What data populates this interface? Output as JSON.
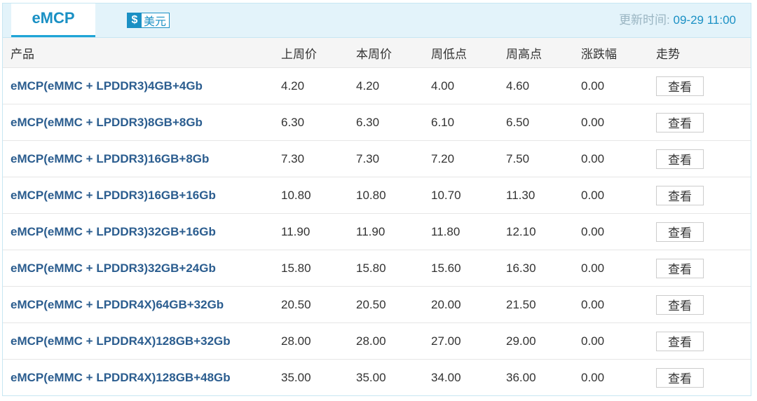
{
  "tabs": {
    "active_label": "eMCP"
  },
  "currency": {
    "icon_glyph": "$",
    "label": "美元"
  },
  "update": {
    "label": "更新时间: ",
    "value": "09-29 11:00"
  },
  "table": {
    "headers": [
      "产品",
      "上周价",
      "本周价",
      "周低点",
      "周高点",
      "涨跌幅",
      "走势"
    ],
    "view_label": "查看",
    "rows": [
      {
        "product": "eMCP(eMMC + LPDDR3)4GB+4Gb",
        "last_week": "4.20",
        "this_week": "4.20",
        "low": "4.00",
        "high": "4.60",
        "change": "0.00"
      },
      {
        "product": "eMCP(eMMC + LPDDR3)8GB+8Gb",
        "last_week": "6.30",
        "this_week": "6.30",
        "low": "6.10",
        "high": "6.50",
        "change": "0.00"
      },
      {
        "product": "eMCP(eMMC + LPDDR3)16GB+8Gb",
        "last_week": "7.30",
        "this_week": "7.30",
        "low": "7.20",
        "high": "7.50",
        "change": "0.00"
      },
      {
        "product": "eMCP(eMMC + LPDDR3)16GB+16Gb",
        "last_week": "10.80",
        "this_week": "10.80",
        "low": "10.70",
        "high": "11.30",
        "change": "0.00"
      },
      {
        "product": "eMCP(eMMC + LPDDR3)32GB+16Gb",
        "last_week": "11.90",
        "this_week": "11.90",
        "low": "11.80",
        "high": "12.10",
        "change": "0.00"
      },
      {
        "product": "eMCP(eMMC + LPDDR3)32GB+24Gb",
        "last_week": "15.80",
        "this_week": "15.80",
        "low": "15.60",
        "high": "16.30",
        "change": "0.00"
      },
      {
        "product": "eMCP(eMMC + LPDDR4X)64GB+32Gb",
        "last_week": "20.50",
        "this_week": "20.50",
        "low": "20.00",
        "high": "21.50",
        "change": "0.00"
      },
      {
        "product": "eMCP(eMMC + LPDDR4X)128GB+32Gb",
        "last_week": "28.00",
        "this_week": "28.00",
        "low": "27.00",
        "high": "29.00",
        "change": "0.00"
      },
      {
        "product": "eMCP(eMMC + LPDDR4X)128GB+48Gb",
        "last_week": "35.00",
        "this_week": "35.00",
        "low": "34.00",
        "high": "36.00",
        "change": "0.00"
      }
    ]
  },
  "colors": {
    "accent": "#1a90c4",
    "header_bar": "#e3f3fa",
    "product_text": "#2b5d8f"
  },
  "icons": {
    "currency": "dollar-icon"
  }
}
